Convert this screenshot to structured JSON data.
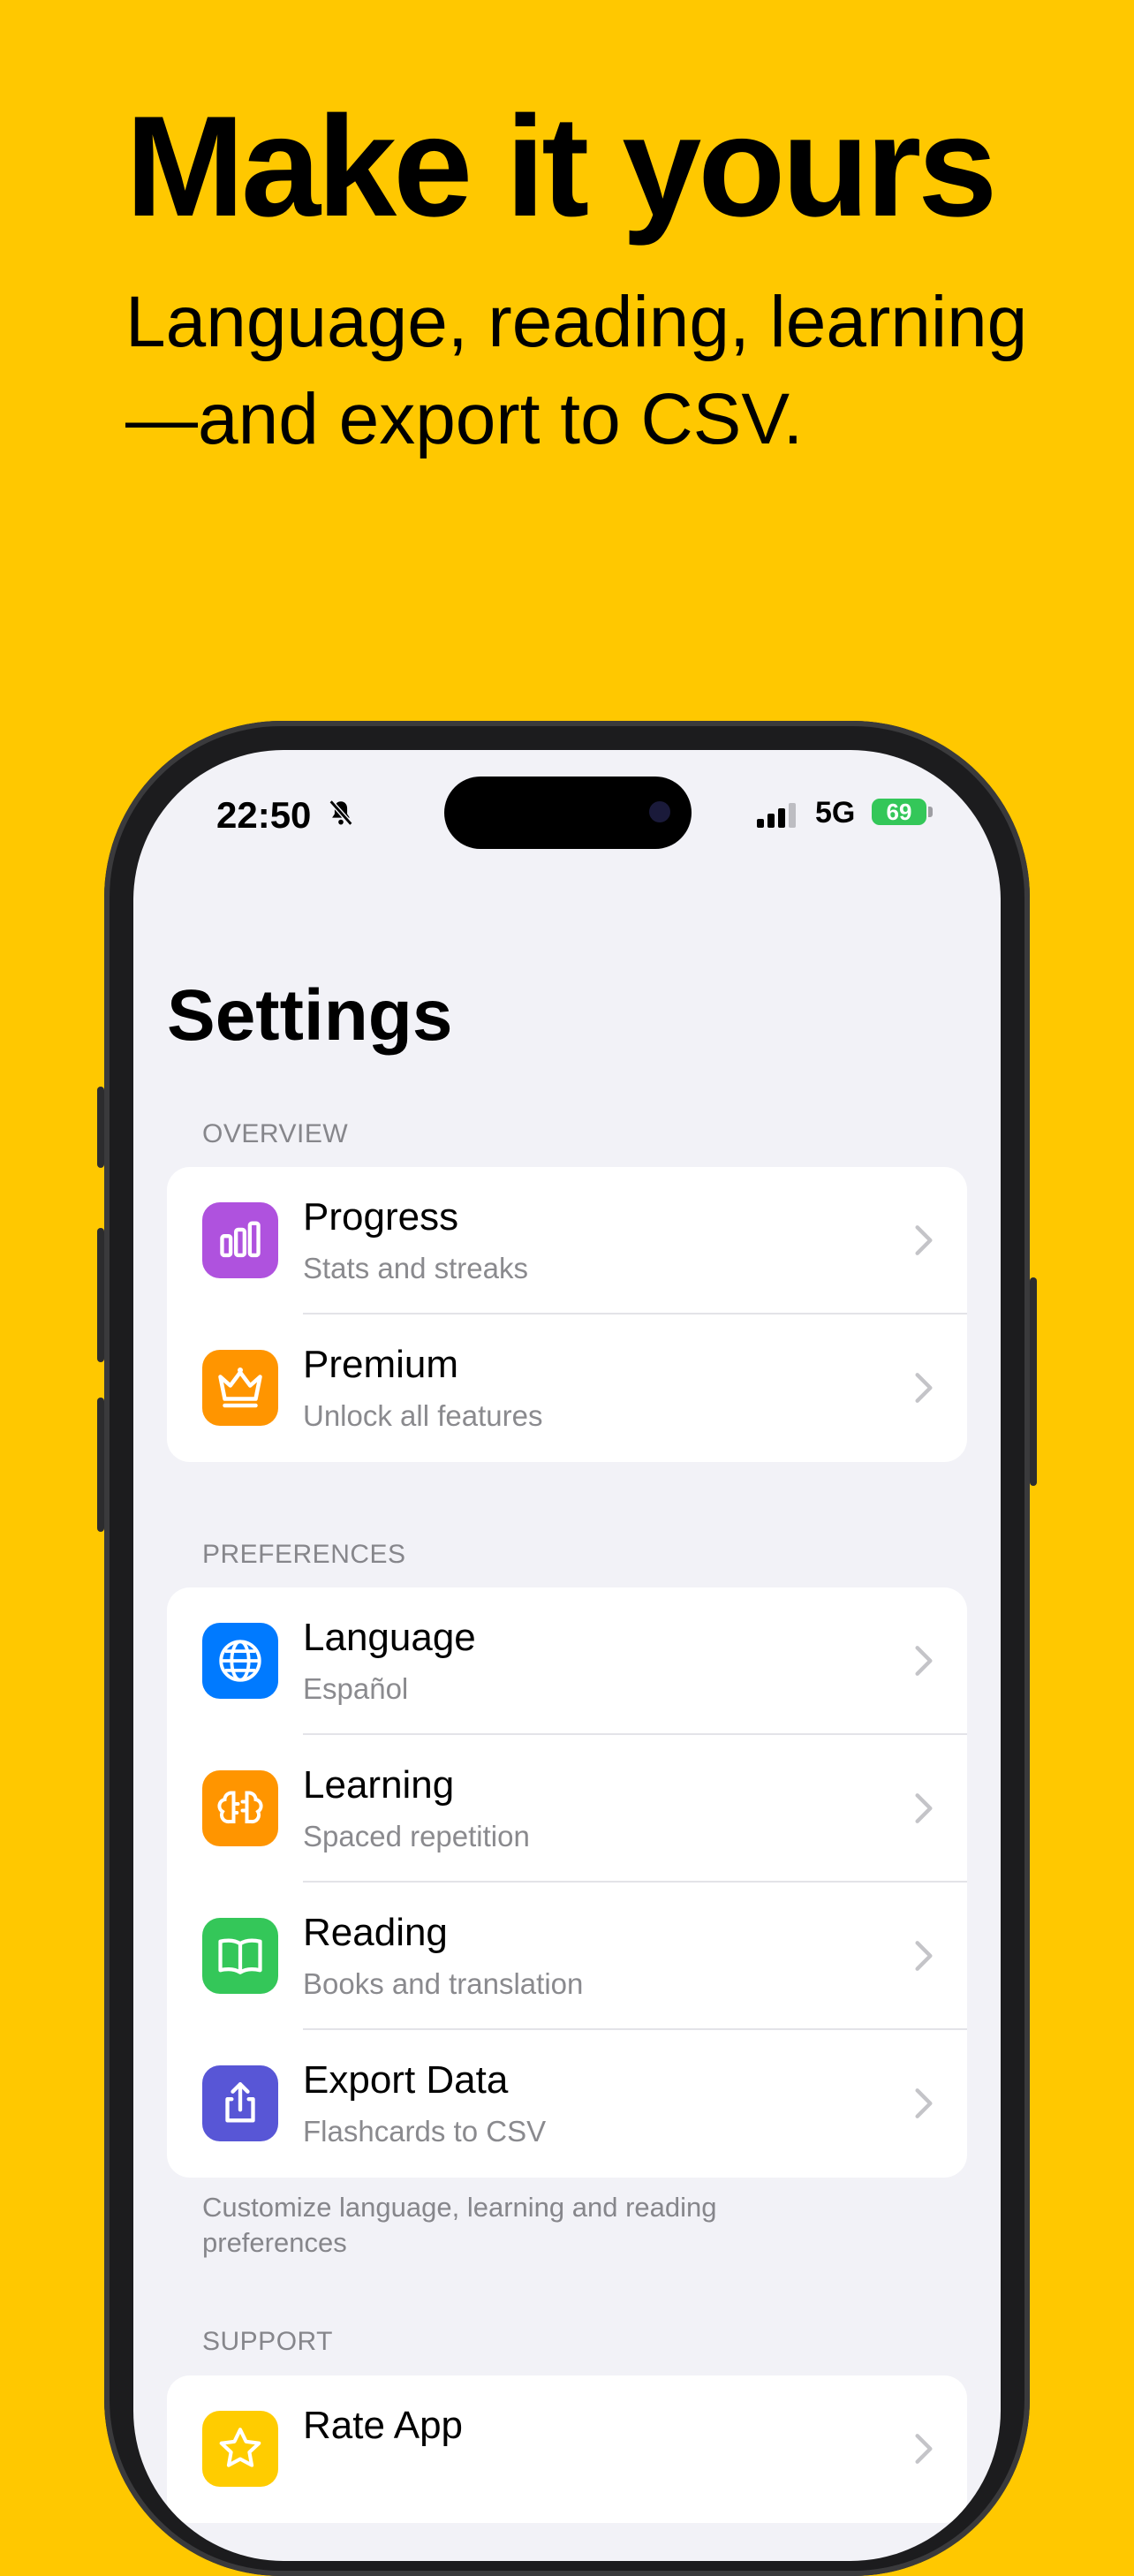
{
  "promo": {
    "headline": "Make it yours",
    "subline": "Language, reading, learning—and export to CSV."
  },
  "status_bar": {
    "time": "22:50",
    "network": "5G",
    "battery": "69"
  },
  "screen_title": "Settings",
  "sections": {
    "overview": {
      "header": "OVERVIEW",
      "rows": [
        {
          "title": "Progress",
          "subtitle": "Stats and streaks",
          "icon": "bar-chart-icon",
          "color": "#AF52DE"
        },
        {
          "title": "Premium",
          "subtitle": "Unlock all features",
          "icon": "crown-icon",
          "color": "#FF9500"
        }
      ]
    },
    "preferences": {
      "header": "PREFERENCES",
      "rows": [
        {
          "title": "Language",
          "subtitle": "Español",
          "icon": "globe-icon",
          "color": "#007AFF"
        },
        {
          "title": "Learning",
          "subtitle": "Spaced repetition",
          "icon": "brain-icon",
          "color": "#FF9500"
        },
        {
          "title": "Reading",
          "subtitle": "Books and translation",
          "icon": "book-icon",
          "color": "#34C759"
        },
        {
          "title": "Export Data",
          "subtitle": "Flashcards to CSV",
          "icon": "share-icon",
          "color": "#5856D6"
        }
      ],
      "footer": "Customize language, learning and reading preferences"
    },
    "support": {
      "header": "SUPPORT",
      "rows": [
        {
          "title": "Rate App",
          "icon": "star-icon",
          "color": "#FFCC00"
        }
      ]
    }
  }
}
